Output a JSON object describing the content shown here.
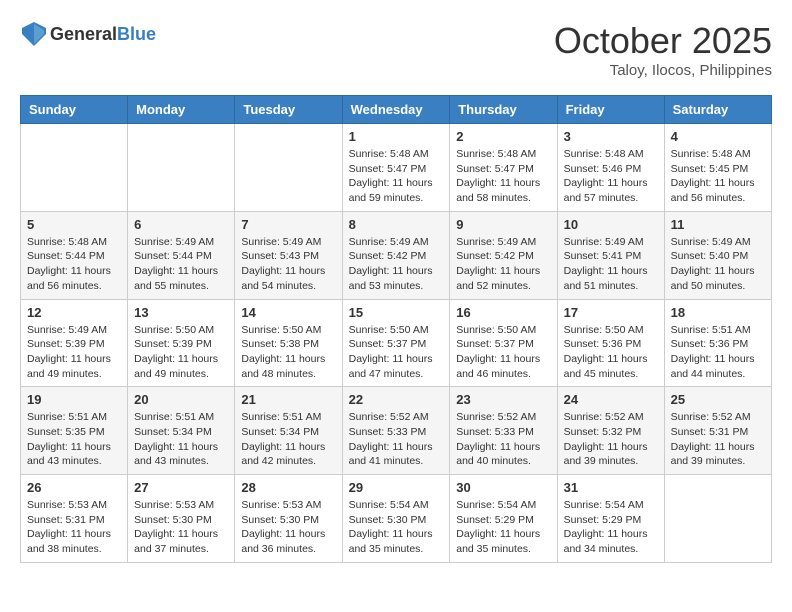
{
  "header": {
    "logo_general": "General",
    "logo_blue": "Blue",
    "month": "October 2025",
    "location": "Taloy, Ilocos, Philippines"
  },
  "days_of_week": [
    "Sunday",
    "Monday",
    "Tuesday",
    "Wednesday",
    "Thursday",
    "Friday",
    "Saturday"
  ],
  "weeks": [
    [
      {
        "day": "",
        "sunrise": "",
        "sunset": "",
        "daylight": ""
      },
      {
        "day": "",
        "sunrise": "",
        "sunset": "",
        "daylight": ""
      },
      {
        "day": "",
        "sunrise": "",
        "sunset": "",
        "daylight": ""
      },
      {
        "day": "1",
        "sunrise": "Sunrise: 5:48 AM",
        "sunset": "Sunset: 5:47 PM",
        "daylight": "Daylight: 11 hours and 59 minutes."
      },
      {
        "day": "2",
        "sunrise": "Sunrise: 5:48 AM",
        "sunset": "Sunset: 5:47 PM",
        "daylight": "Daylight: 11 hours and 58 minutes."
      },
      {
        "day": "3",
        "sunrise": "Sunrise: 5:48 AM",
        "sunset": "Sunset: 5:46 PM",
        "daylight": "Daylight: 11 hours and 57 minutes."
      },
      {
        "day": "4",
        "sunrise": "Sunrise: 5:48 AM",
        "sunset": "Sunset: 5:45 PM",
        "daylight": "Daylight: 11 hours and 56 minutes."
      }
    ],
    [
      {
        "day": "5",
        "sunrise": "Sunrise: 5:48 AM",
        "sunset": "Sunset: 5:44 PM",
        "daylight": "Daylight: 11 hours and 56 minutes."
      },
      {
        "day": "6",
        "sunrise": "Sunrise: 5:49 AM",
        "sunset": "Sunset: 5:44 PM",
        "daylight": "Daylight: 11 hours and 55 minutes."
      },
      {
        "day": "7",
        "sunrise": "Sunrise: 5:49 AM",
        "sunset": "Sunset: 5:43 PM",
        "daylight": "Daylight: 11 hours and 54 minutes."
      },
      {
        "day": "8",
        "sunrise": "Sunrise: 5:49 AM",
        "sunset": "Sunset: 5:42 PM",
        "daylight": "Daylight: 11 hours and 53 minutes."
      },
      {
        "day": "9",
        "sunrise": "Sunrise: 5:49 AM",
        "sunset": "Sunset: 5:42 PM",
        "daylight": "Daylight: 11 hours and 52 minutes."
      },
      {
        "day": "10",
        "sunrise": "Sunrise: 5:49 AM",
        "sunset": "Sunset: 5:41 PM",
        "daylight": "Daylight: 11 hours and 51 minutes."
      },
      {
        "day": "11",
        "sunrise": "Sunrise: 5:49 AM",
        "sunset": "Sunset: 5:40 PM",
        "daylight": "Daylight: 11 hours and 50 minutes."
      }
    ],
    [
      {
        "day": "12",
        "sunrise": "Sunrise: 5:49 AM",
        "sunset": "Sunset: 5:39 PM",
        "daylight": "Daylight: 11 hours and 49 minutes."
      },
      {
        "day": "13",
        "sunrise": "Sunrise: 5:50 AM",
        "sunset": "Sunset: 5:39 PM",
        "daylight": "Daylight: 11 hours and 49 minutes."
      },
      {
        "day": "14",
        "sunrise": "Sunrise: 5:50 AM",
        "sunset": "Sunset: 5:38 PM",
        "daylight": "Daylight: 11 hours and 48 minutes."
      },
      {
        "day": "15",
        "sunrise": "Sunrise: 5:50 AM",
        "sunset": "Sunset: 5:37 PM",
        "daylight": "Daylight: 11 hours and 47 minutes."
      },
      {
        "day": "16",
        "sunrise": "Sunrise: 5:50 AM",
        "sunset": "Sunset: 5:37 PM",
        "daylight": "Daylight: 11 hours and 46 minutes."
      },
      {
        "day": "17",
        "sunrise": "Sunrise: 5:50 AM",
        "sunset": "Sunset: 5:36 PM",
        "daylight": "Daylight: 11 hours and 45 minutes."
      },
      {
        "day": "18",
        "sunrise": "Sunrise: 5:51 AM",
        "sunset": "Sunset: 5:36 PM",
        "daylight": "Daylight: 11 hours and 44 minutes."
      }
    ],
    [
      {
        "day": "19",
        "sunrise": "Sunrise: 5:51 AM",
        "sunset": "Sunset: 5:35 PM",
        "daylight": "Daylight: 11 hours and 43 minutes."
      },
      {
        "day": "20",
        "sunrise": "Sunrise: 5:51 AM",
        "sunset": "Sunset: 5:34 PM",
        "daylight": "Daylight: 11 hours and 43 minutes."
      },
      {
        "day": "21",
        "sunrise": "Sunrise: 5:51 AM",
        "sunset": "Sunset: 5:34 PM",
        "daylight": "Daylight: 11 hours and 42 minutes."
      },
      {
        "day": "22",
        "sunrise": "Sunrise: 5:52 AM",
        "sunset": "Sunset: 5:33 PM",
        "daylight": "Daylight: 11 hours and 41 minutes."
      },
      {
        "day": "23",
        "sunrise": "Sunrise: 5:52 AM",
        "sunset": "Sunset: 5:33 PM",
        "daylight": "Daylight: 11 hours and 40 minutes."
      },
      {
        "day": "24",
        "sunrise": "Sunrise: 5:52 AM",
        "sunset": "Sunset: 5:32 PM",
        "daylight": "Daylight: 11 hours and 39 minutes."
      },
      {
        "day": "25",
        "sunrise": "Sunrise: 5:52 AM",
        "sunset": "Sunset: 5:31 PM",
        "daylight": "Daylight: 11 hours and 39 minutes."
      }
    ],
    [
      {
        "day": "26",
        "sunrise": "Sunrise: 5:53 AM",
        "sunset": "Sunset: 5:31 PM",
        "daylight": "Daylight: 11 hours and 38 minutes."
      },
      {
        "day": "27",
        "sunrise": "Sunrise: 5:53 AM",
        "sunset": "Sunset: 5:30 PM",
        "daylight": "Daylight: 11 hours and 37 minutes."
      },
      {
        "day": "28",
        "sunrise": "Sunrise: 5:53 AM",
        "sunset": "Sunset: 5:30 PM",
        "daylight": "Daylight: 11 hours and 36 minutes."
      },
      {
        "day": "29",
        "sunrise": "Sunrise: 5:54 AM",
        "sunset": "Sunset: 5:30 PM",
        "daylight": "Daylight: 11 hours and 35 minutes."
      },
      {
        "day": "30",
        "sunrise": "Sunrise: 5:54 AM",
        "sunset": "Sunset: 5:29 PM",
        "daylight": "Daylight: 11 hours and 35 minutes."
      },
      {
        "day": "31",
        "sunrise": "Sunrise: 5:54 AM",
        "sunset": "Sunset: 5:29 PM",
        "daylight": "Daylight: 11 hours and 34 minutes."
      },
      {
        "day": "",
        "sunrise": "",
        "sunset": "",
        "daylight": ""
      }
    ]
  ]
}
